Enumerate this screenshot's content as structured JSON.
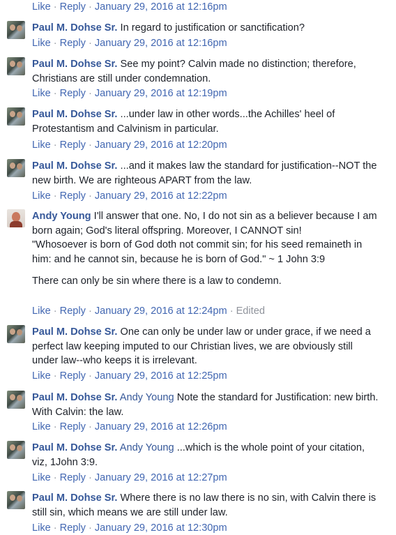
{
  "labels": {
    "like": "Like",
    "reply": "Reply",
    "dot": "·",
    "edited": "Edited"
  },
  "top_timestamp": "January 29, 2016 at 12:16pm",
  "comments": [
    {
      "author": "Paul M. Dohse Sr.",
      "mention": "",
      "text": "In regard to justification or sanctification?",
      "timestamp": "January 29, 2016 at 12:16pm"
    },
    {
      "author": "Paul M. Dohse Sr.",
      "mention": "",
      "text": "See my point? Calvin made no distinction; therefore, Christians are still under condemnation.",
      "timestamp": "January 29, 2016 at 12:19pm"
    },
    {
      "author": "Paul M. Dohse Sr.",
      "mention": "",
      "text": "...under law in other words...the Achilles' heel of Protestantism and Calvinism in particular.",
      "timestamp": "January 29, 2016 at 12:20pm"
    },
    {
      "author": "Paul M. Dohse Sr.",
      "mention": "",
      "text": "...and it makes law the standard for justification--NOT the new birth. We are righteous APART from the law.",
      "timestamp": "January 29, 2016 at 12:22pm"
    },
    {
      "author": "Andy Young",
      "mention": "",
      "text": "I'll answer that one. No, I do not sin as a believer because I am born again; God's literal offspring. Moreover, I CANNOT sin!",
      "quote": "\"Whosoever is born of God doth not commit sin; for his seed remaineth in him: and he cannot sin, because he is born of God.\" ~ 1 John 3:9",
      "extra": "There can only be sin where there is a law to condemn.",
      "timestamp": "January 29, 2016 at 12:24pm"
    },
    {
      "author": "Paul M. Dohse Sr.",
      "mention": "",
      "text": "One can only be under law or under grace, if we need a perfect law keeping imputed to our Christian lives, we are obviously still under law--who keeps it is irrelevant.",
      "timestamp": "January 29, 2016 at 12:25pm"
    },
    {
      "author": "Paul M. Dohse Sr.",
      "mention": "Andy Young",
      "text": "Note the standard for Justification: new birth. With Calvin: the law.",
      "timestamp": "January 29, 2016 at 12:26pm"
    },
    {
      "author": "Paul M. Dohse Sr.",
      "mention": "Andy Young",
      "text": "...which is the whole point of your citation, viz, 1John 3:9.",
      "timestamp": "January 29, 2016 at 12:27pm"
    },
    {
      "author": "Paul M. Dohse Sr.",
      "mention": "",
      "text": "Where there is no law there is no sin, with Calvin there is still sin, which means we are still under law.",
      "timestamp": "January 29, 2016 at 12:30pm"
    }
  ]
}
